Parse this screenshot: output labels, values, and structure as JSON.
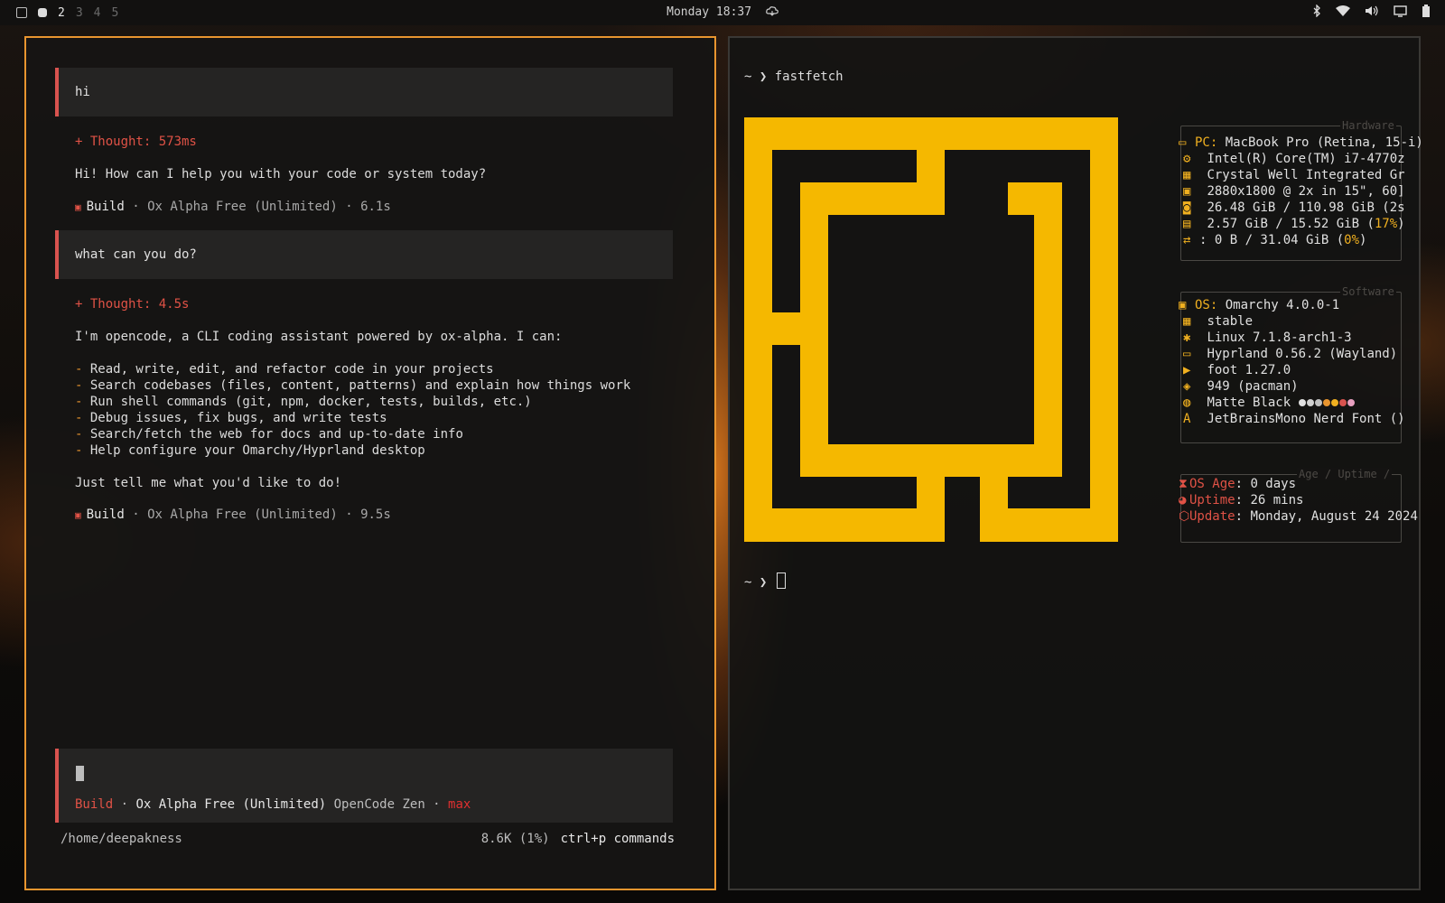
{
  "topbar": {
    "workspaces": [
      "2",
      "3",
      "4",
      "5"
    ],
    "active_workspace": "2",
    "clock": "Monday 18:37"
  },
  "left": {
    "messages": [
      {
        "user": "hi",
        "thought": "+ Thought: 573ms",
        "reply": [
          "Hi! How can I help you with your code or system today?"
        ],
        "meta": {
          "build": "Build",
          "rest": " · Ox Alpha Free (Unlimited) · 6.1s"
        }
      },
      {
        "user": "what can you do?",
        "thought": "+ Thought: 4.5s",
        "reply_intro": "I'm opencode, a CLI coding assistant powered by ox-alpha. I can:",
        "bullets": [
          "Read, write, edit, and refactor code in your projects",
          "Search codebases (files, content, patterns) and explain how things work",
          "Run shell commands (git, npm, docker, tests, builds, etc.)",
          "Debug issues, fix bugs, and write tests",
          "Search/fetch the web for docs and up-to-date info",
          "Help configure your Omarchy/Hyprland desktop"
        ],
        "reply_outro": "Just tell me what you'd like to do!",
        "meta": {
          "build": "Build",
          "rest": " · Ox Alpha Free (Unlimited) · 9.5s"
        }
      }
    ],
    "input": {
      "agent": "Build",
      "sep": " · ",
      "model": "Ox Alpha Free (Unlimited)",
      "provider": " OpenCode Zen · ",
      "variant": "max"
    },
    "status": {
      "path": "/home/deepakness",
      "tokens": "8.6K (1%)",
      "hint": "ctrl+p commands"
    }
  },
  "right": {
    "prompt1": "~ ❯ fastfetch",
    "prompt2": "~ ❯ ",
    "sections": {
      "hardware": "Hardware",
      "software": "Software",
      "age": "Age / Uptime /"
    },
    "hardware": {
      "pc_key": "PC",
      "pc": "MacBook Pro (Retina, 15-i)",
      "cpu": "Intel(R) Core(TM) i7-4770z",
      "gpu": "Crystal Well Integrated Gr",
      "display": "2880x1800 @ 2x in 15\", 60]",
      "disk": "26.48 GiB / 110.98 GiB (2s",
      "mem_prefix": "2.57 GiB / 15.52 GiB (",
      "mem_pct": "17%",
      "mem_suffix": ")",
      "swap_prefix": ": 0 B / 31.04 GiB (",
      "swap_pct": "0%",
      "swap_suffix": ")"
    },
    "software": {
      "os_key": "OS",
      "os": "Omarchy 4.0.0-1",
      "channel": "stable",
      "kernel": "Linux 7.1.8-arch1-3",
      "wm": "Hyprland 0.56.2 (Wayland)",
      "terminal": "foot 1.27.0",
      "packages": "949 (pacman)",
      "theme": "Matte Black",
      "font": "JetBrainsMono Nerd Font ()"
    },
    "age": {
      "os_age_key": "OS Age",
      "os_age": "0 days",
      "uptime_key": "Uptime",
      "uptime": "26 mins",
      "update_key": "Update",
      "update": "Monday, August 24 2024"
    },
    "colors": {
      "accent": "#f0b020",
      "logo": "#f5b800",
      "border_active": "#e8952f"
    }
  }
}
